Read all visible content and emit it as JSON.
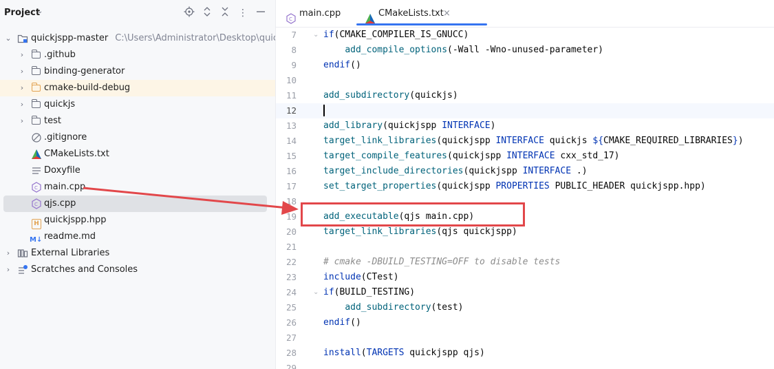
{
  "project_panel": {
    "title": "Project",
    "root": {
      "name": "quickjspp-master",
      "path": "C:\\Users\\Administrator\\Desktop\\quickjspp"
    },
    "items": [
      {
        "name": ".github",
        "type": "folder"
      },
      {
        "name": "binding-generator",
        "type": "folder"
      },
      {
        "name": "cmake-build-debug",
        "type": "folder-excluded"
      },
      {
        "name": "quickjs",
        "type": "folder"
      },
      {
        "name": "test",
        "type": "folder"
      },
      {
        "name": ".gitignore",
        "type": "gitignore-icon"
      },
      {
        "name": "CMakeLists.txt",
        "type": "cmake-icon"
      },
      {
        "name": "Doxyfile",
        "type": "text-icon"
      },
      {
        "name": "main.cpp",
        "type": "cpp-icon"
      },
      {
        "name": "qjs.cpp",
        "type": "cpp-icon",
        "selected": true
      },
      {
        "name": "quickjspp.hpp",
        "type": "hpp-icon"
      },
      {
        "name": "readme.md",
        "type": "markdown-icon"
      }
    ],
    "external_libraries": "External Libraries",
    "scratches": "Scratches and Consoles"
  },
  "editor": {
    "tabs": [
      {
        "label": "main.cpp",
        "active": false
      },
      {
        "label": "CMakeLists.txt",
        "active": true
      }
    ],
    "close_glyph": "×",
    "md_glyph": "M↓",
    "hpp_glyph": "H",
    "lines": [
      {
        "num": "7",
        "text": "if(CMAKE_COMPILER_IS_GNUCC)"
      },
      {
        "num": "8",
        "text": "    add_compile_options(-Wall -Wno-unused-parameter)"
      },
      {
        "num": "9",
        "text": "endif()"
      },
      {
        "num": "10",
        "text": ""
      },
      {
        "num": "11",
        "text": "add_subdirectory(quickjs)"
      },
      {
        "num": "12",
        "text": ""
      },
      {
        "num": "13",
        "text": "add_library(quickjspp INTERFACE)"
      },
      {
        "num": "14",
        "text": "target_link_libraries(quickjspp INTERFACE quickjs ${CMAKE_REQUIRED_LIBRARIES})"
      },
      {
        "num": "15",
        "text": "target_compile_features(quickjspp INTERFACE cxx_std_17)"
      },
      {
        "num": "16",
        "text": "target_include_directories(quickjspp INTERFACE .)"
      },
      {
        "num": "17",
        "text": "set_target_properties(quickjspp PROPERTIES PUBLIC_HEADER quickjspp.hpp)"
      },
      {
        "num": "18",
        "text": ""
      },
      {
        "num": "19",
        "text": "add_executable(qjs main.cpp)"
      },
      {
        "num": "20",
        "text": "target_link_libraries(qjs quickjspp)"
      },
      {
        "num": "21",
        "text": ""
      },
      {
        "num": "22",
        "text": "# cmake -DBUILD_TESTING=OFF to disable tests"
      },
      {
        "num": "23",
        "text": "include(CTest)"
      },
      {
        "num": "24",
        "text": "if(BUILD_TESTING)"
      },
      {
        "num": "25",
        "text": "    add_subdirectory(test)"
      },
      {
        "num": "26",
        "text": "endif()"
      },
      {
        "num": "27",
        "text": ""
      },
      {
        "num": "28",
        "text": "install(TARGETS quickjspp qjs)"
      },
      {
        "num": "29",
        "text": ""
      }
    ],
    "current_line": "12"
  },
  "annotation": {
    "color": "#e2474a",
    "from": "main.cpp",
    "to": "add_executable(qjs main.cpp)"
  },
  "colors": {
    "keyword": "#0033b3",
    "function": "#00627a",
    "comment": "#8c8c8c",
    "accent": "#3574f0"
  }
}
